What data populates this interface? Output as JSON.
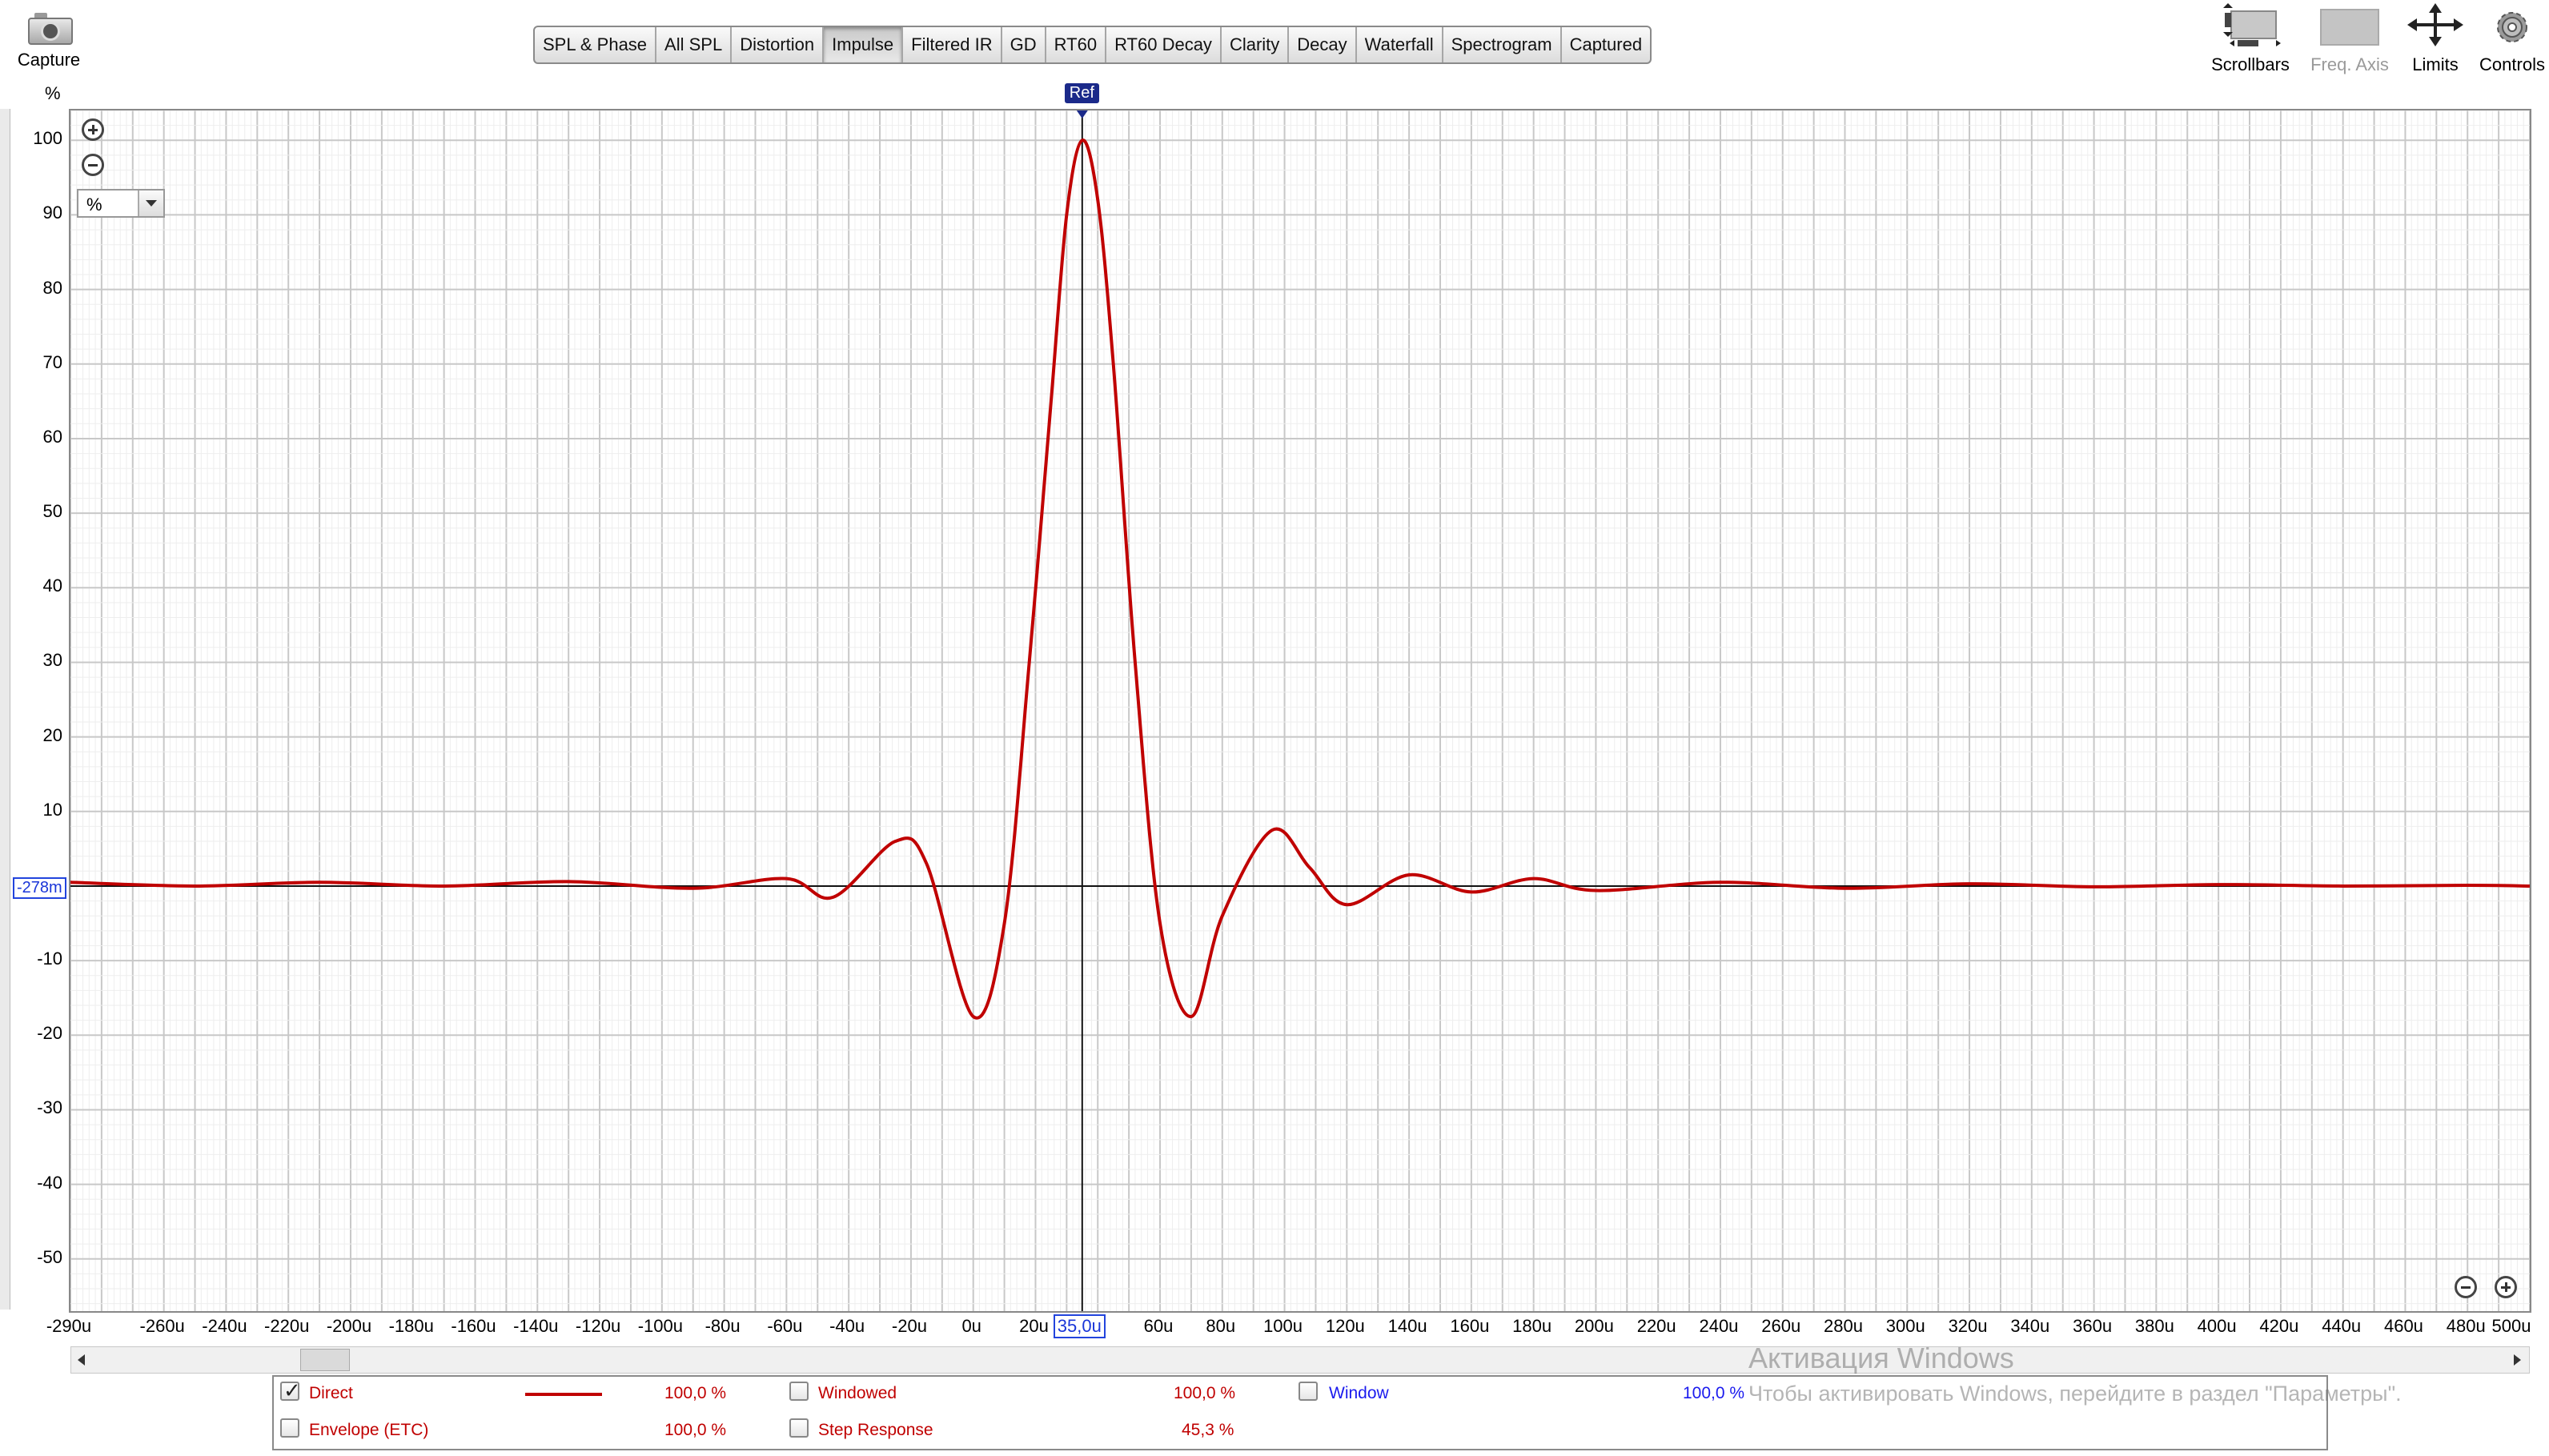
{
  "toolbar": {
    "capture_label": "Capture",
    "tabs": [
      "SPL & Phase",
      "All SPL",
      "Distortion",
      "Impulse",
      "Filtered IR",
      "GD",
      "RT60",
      "RT60 Decay",
      "Clarity",
      "Decay",
      "Waterfall",
      "Spectrogram",
      "Captured"
    ],
    "active_tab": "Impulse",
    "right_tools": [
      {
        "label": "Scrollbars",
        "icon": "scrollbars-icon",
        "enabled": true
      },
      {
        "label": "Freq. Axis",
        "icon": "freq-axis-icon",
        "enabled": false
      },
      {
        "label": "Limits",
        "icon": "limits-icon",
        "enabled": true
      },
      {
        "label": "Controls",
        "icon": "gear-icon",
        "enabled": true
      }
    ]
  },
  "plot": {
    "y_unit": "%",
    "unit_select": "%",
    "ref_label": "Ref",
    "cursor_x_readout": "35,0u",
    "cursor_y_readout": "-278m"
  },
  "chart_data": {
    "type": "line",
    "title": "",
    "xlabel": "",
    "ylabel": "%",
    "x_unit": "s",
    "xlim": [
      -290,
      500
    ],
    "x_scale": "microseconds",
    "ylim": [
      -57,
      104
    ],
    "x_tick_labels": [
      "-290u",
      "-260u",
      "-240u",
      "-220u",
      "-200u",
      "-180u",
      "-160u",
      "-140u",
      "-120u",
      "-100u",
      "-80u",
      "-60u",
      "-40u",
      "-20u",
      "0u",
      "20u",
      "35,0u",
      "60u",
      "80u",
      "100u",
      "120u",
      "140u",
      "160u",
      "180u",
      "200u",
      "220u",
      "240u",
      "260u",
      "280u",
      "300u",
      "320u",
      "340u",
      "360u",
      "380u",
      "400u",
      "420u",
      "440u",
      "460u",
      "480u",
      "500u"
    ],
    "y_ticks": [
      100,
      90,
      80,
      70,
      60,
      50,
      40,
      30,
      20,
      10,
      -10,
      -20,
      -30,
      -40,
      -50
    ],
    "grid": true,
    "reference_x": 35,
    "series": [
      {
        "name": "Direct",
        "color": "#c00000",
        "x": [
          -290,
          -250,
          -210,
          -170,
          -130,
          -90,
          -60,
          -45,
          -25,
          -15,
          0,
          10,
          18,
          25,
          30,
          35,
          40,
          45,
          52,
          60,
          70,
          80,
          96,
          108,
          120,
          140,
          160,
          180,
          200,
          240,
          280,
          320,
          360,
          400,
          440,
          480,
          500
        ],
        "y": [
          0.5,
          0,
          0.5,
          0,
          0.6,
          -0.3,
          1.0,
          -1.5,
          6.0,
          3,
          -17.5,
          -5,
          30,
          65,
          90,
          100,
          92,
          70,
          30,
          -5,
          -17.5,
          -4,
          7.5,
          2.5,
          -2.5,
          1.5,
          -0.8,
          1.0,
          -0.6,
          0.5,
          -0.3,
          0.3,
          -0.1,
          0.2,
          0,
          0.1,
          0
        ]
      }
    ]
  },
  "legend": {
    "rows": [
      {
        "label": "Direct",
        "checked": true,
        "value": "100,0 %",
        "color": "#c00000"
      },
      {
        "label": "Envelope (ETC)",
        "checked": false,
        "value": "100,0 %",
        "color": "#c00000"
      },
      {
        "label": "Windowed",
        "checked": false,
        "value": "100,0 %",
        "color": "#c00000"
      },
      {
        "label": "Step Response",
        "checked": false,
        "value": "45,3 %",
        "color": "#c00000"
      },
      {
        "label": "Window",
        "checked": false,
        "value": "100,0 %",
        "color": "#1a1aee"
      }
    ]
  },
  "watermark": {
    "line1": "Активация Windows",
    "line2": "Чтобы активировать Windows, перейдите в раздел \"Параметры\"."
  }
}
